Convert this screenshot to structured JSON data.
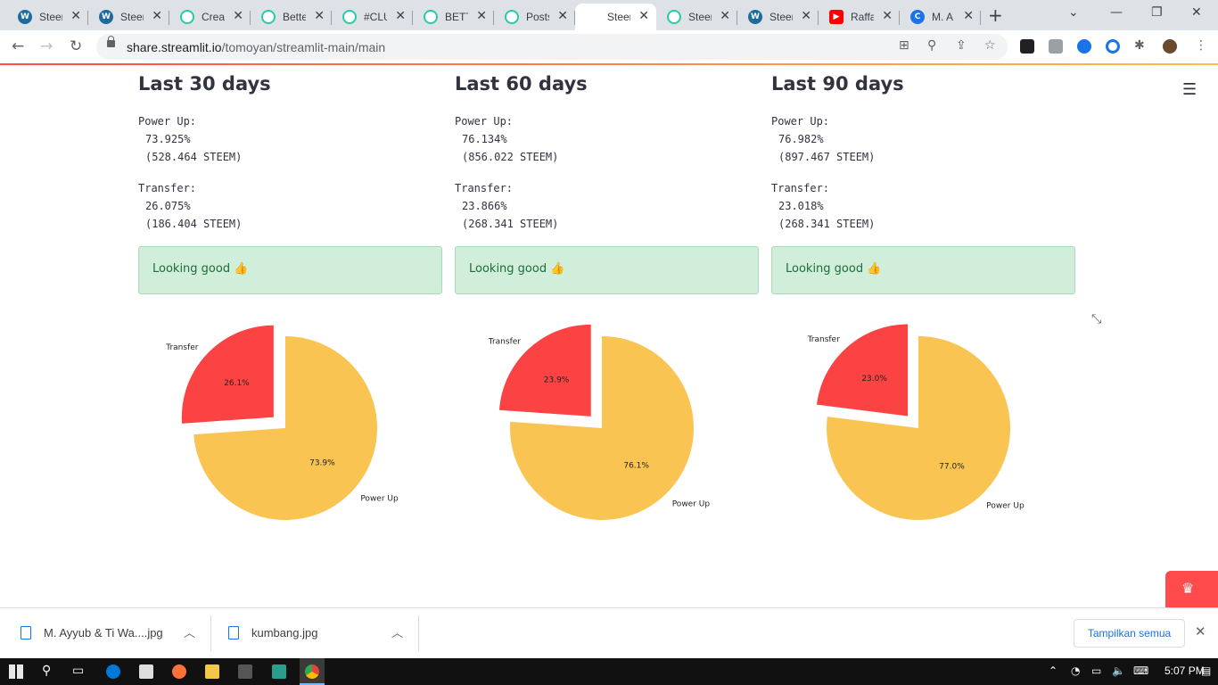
{
  "browser": {
    "tabs": [
      {
        "label": "Steem",
        "icon": "wordpress-icon"
      },
      {
        "label": "Steem",
        "icon": "wordpress-icon"
      },
      {
        "label": "Create",
        "icon": "steemit-icon"
      },
      {
        "label": "Better",
        "icon": "steemit-icon"
      },
      {
        "label": "#CLUB",
        "icon": "steemit-icon"
      },
      {
        "label": "BETTER",
        "icon": "steemit-icon"
      },
      {
        "label": "Posts",
        "icon": "steemit-icon"
      },
      {
        "label": "Steem",
        "icon": "fish-icon",
        "active": true
      },
      {
        "label": "Steem",
        "icon": "steemit-icon"
      },
      {
        "label": "Steem",
        "icon": "wordpress-icon"
      },
      {
        "label": "Raffa",
        "icon": "youtube-icon"
      },
      {
        "label": "M. A",
        "icon": "c-icon"
      }
    ],
    "url_host": "share.streamlit.io",
    "url_path": "/tomoyan/streamlit-main/main"
  },
  "columns": [
    {
      "title": "Last 30 days",
      "power_up_label": "Power Up:",
      "power_up_pct": "73.925%",
      "power_up_amount": "(528.464 STEEM)",
      "transfer_label": "Transfer:",
      "transfer_pct": "26.075%",
      "transfer_amount": "(186.404 STEEM)",
      "status": "Looking good 👍"
    },
    {
      "title": "Last 60 days",
      "power_up_label": "Power Up:",
      "power_up_pct": "76.134%",
      "power_up_amount": "(856.022 STEEM)",
      "transfer_label": "Transfer:",
      "transfer_pct": "23.866%",
      "transfer_amount": "(268.341 STEEM)",
      "status": "Looking good 👍"
    },
    {
      "title": "Last 90 days",
      "power_up_label": "Power Up:",
      "power_up_pct": "76.982%",
      "power_up_amount": "(897.467 STEEM)",
      "transfer_label": "Transfer:",
      "transfer_pct": "23.018%",
      "transfer_amount": "(268.341 STEEM)",
      "status": "Looking good 👍"
    }
  ],
  "chart_data": [
    {
      "type": "pie",
      "categories": [
        "Transfer",
        "Power Up"
      ],
      "values": [
        26.1,
        73.9
      ],
      "labels": [
        "26.1%",
        "73.9%"
      ],
      "colors": [
        "#fc4343",
        "#f9c451"
      ],
      "exploded": "Transfer"
    },
    {
      "type": "pie",
      "categories": [
        "Transfer",
        "Power Up"
      ],
      "values": [
        23.9,
        76.1
      ],
      "labels": [
        "23.9%",
        "76.1%"
      ],
      "colors": [
        "#fc4343",
        "#f9c451"
      ],
      "exploded": "Transfer"
    },
    {
      "type": "pie",
      "categories": [
        "Transfer",
        "Power Up"
      ],
      "values": [
        23.0,
        77.0
      ],
      "labels": [
        "23.0%",
        "77.0%"
      ],
      "colors": [
        "#fc4343",
        "#f9c451"
      ],
      "exploded": "Transfer"
    }
  ],
  "downloads": [
    {
      "name": "M. Ayyub & Ti Wa....jpg"
    },
    {
      "name": "kumbang.jpg"
    }
  ],
  "show_all_label": "Tampilkan semua",
  "clock": "5:07 PM"
}
